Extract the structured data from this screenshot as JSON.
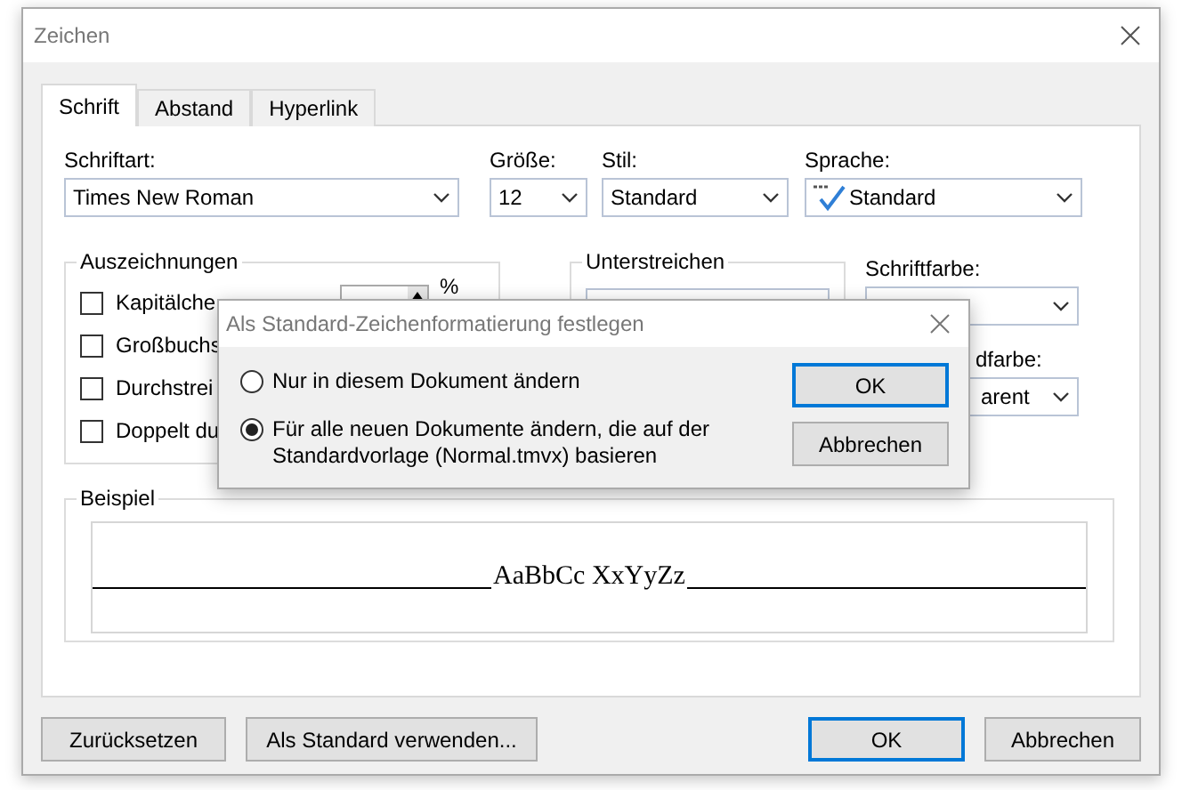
{
  "window": {
    "title": "Zeichen"
  },
  "tabs": [
    {
      "label": "Schrift",
      "selected": true
    },
    {
      "label": "Abstand",
      "selected": false
    },
    {
      "label": "Hyperlink",
      "selected": false
    }
  ],
  "font_fields": [
    {
      "label": "Schriftart:",
      "value": "Times New Roman",
      "kind": "plain"
    },
    {
      "label": "Größe:",
      "value": "12",
      "kind": "plain"
    },
    {
      "label": "Stil:",
      "value": "Standard",
      "kind": "plain"
    },
    {
      "label": "Sprache:",
      "value": "Standard",
      "kind": "language"
    }
  ],
  "effects": {
    "title": "Auszeichnungen",
    "spinner_unit": "%",
    "items": [
      {
        "label": "Kapitälche",
        "checked": false
      },
      {
        "label": "Großbuchs",
        "checked": false
      },
      {
        "label": "Durchstrei",
        "checked": false
      },
      {
        "label": "Doppelt du",
        "checked": false
      }
    ]
  },
  "underline": {
    "title": "Unterstreichen"
  },
  "font_color": {
    "label": "Schriftfarbe:"
  },
  "highlight": {
    "label": "dfarbe:",
    "value": "arent"
  },
  "preview": {
    "title": "Beispiel",
    "sample": "AaBbCc XxYyZz"
  },
  "buttons": [
    {
      "label": "Zurücksetzen",
      "focused": false
    },
    {
      "label": "Als Standard verwenden...",
      "focused": false
    },
    {
      "label": "OK",
      "focused": true
    },
    {
      "label": "Abbrechen",
      "focused": false
    }
  ],
  "popup": {
    "title": "Als Standard-Zeichenformatierung festlegen",
    "options": [
      {
        "label": "Nur in diesem Dokument ändern",
        "selected": false
      },
      {
        "label": "Für alle neuen Dokumente ändern, die auf der Standardvorlage (Normal.tmvx) basieren",
        "selected": true
      }
    ],
    "buttons": [
      {
        "label": "OK",
        "focused": true
      },
      {
        "label": "Abbrechen",
        "focused": false
      }
    ]
  }
}
